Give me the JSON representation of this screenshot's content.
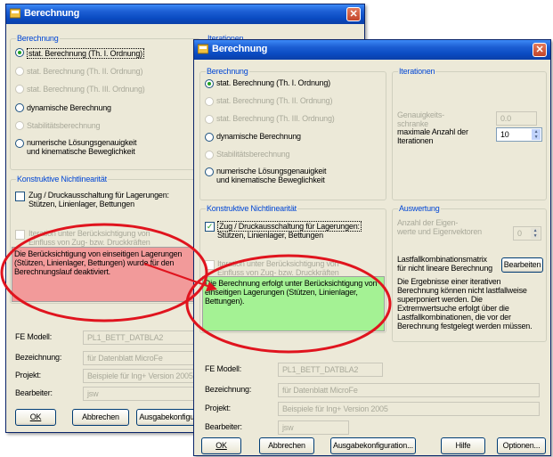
{
  "colors": {
    "title_gradient": "#0a4bc2",
    "group_title": "#0046d5",
    "red_notice": "#f29a9a",
    "green_notice": "#a4f294",
    "ellipse": "#e0141e",
    "arrow": "#e0141e"
  },
  "back": {
    "title": "Berechnung",
    "calc_group": "Berechnung",
    "options": [
      "stat. Berechnung (Th. I. Ordnung)",
      "stat. Berechnung (Th. II. Ordnung)",
      "stat. Berechnung (Th. III. Ordnung)",
      "dynamische Berechnung",
      "Stabilitätsberechnung",
      "numerische Lösungsgenauigkeit",
      "und kinematische Beweglichkeit"
    ],
    "iter_peek": "Iterationen",
    "nonlin_group": "Konstruktive Nichtlinearität",
    "zug_line1": "Zug / Druckausschaltung für Lagerungen:",
    "zug_line2": "Stützen, Linienlager, Bettungen",
    "iter_line1": "Iteration unter Berücksichtigung von",
    "iter_line2": "Einfluss von Zug- bzw. Druckkräften",
    "notice": "Die Berücksichtigung von einseitigen Lagerungen (Stützen, Linienlager, Bettungen) wurde für den Berechnungslauf deaktiviert.",
    "fe_label": "FE Modell:",
    "fe_value": "PL1_BETT_DATBLA2",
    "bez_label": "Bezeichnung:",
    "bez_value": "für Datenblatt MicroFe",
    "proj_label": "Projekt:",
    "proj_value": "Beispiele für Ing+ Version 2005",
    "bearb_label": "Bearbeiter:",
    "bearb_value": "jsw",
    "ok": "OK",
    "abbrechen": "Abbrechen",
    "ausgabe": "Ausgabekonfigura"
  },
  "front": {
    "title": "Berechnung",
    "calc_group": "Berechnung",
    "options": [
      "stat. Berechnung (Th. I. Ordnung)",
      "stat. Berechnung (Th. II. Ordnung)",
      "stat. Berechnung (Th. III. Ordnung)",
      "dynamische Berechnung",
      "Stabilitätsberechnung",
      "numerische Lösungsgenauigkeit",
      "und kinematische Beweglichkeit"
    ],
    "iter_group": "Iterationen",
    "genauig_line1": "Genauigkeits-",
    "genauig_line2": "schranke",
    "genauig_value": "0.0",
    "maxiter_line1": "maximale Anzahl der",
    "maxiter_line2": "Iterationen",
    "maxiter_value": "10",
    "nonlin_group": "Konstruktive Nichtlinearität",
    "zug_line1": "Zug / Druckausschaltung für Lagerungen:",
    "zug_line2": "Stützen, Linienlager, Bettungen",
    "iter_line1": "Iteration unter Berücksichtigung von",
    "iter_line2": "Einfluss von Zug- bzw. Druckkräften",
    "notice": "Die Berechnung erfolgt unter Berücksichtigung von einseitigen Lagerungen (Stützen, Linienlager, Bettungen).",
    "ausw_group": "Auswertung",
    "eigen_line1": "Anzahl der Eigen-",
    "eigen_line2": "werte und Eigenvektoren",
    "eigen_value": "0",
    "matrix_line1": "Lastfallkombinationsmatrix",
    "matrix_line2": "für nicht lineare Berechnung",
    "bearbeiten": "Bearbeiten",
    "ausw_text": "Die Ergebnisse einer iterativen Berechnung können nicht lastfallweise superponiert werden. Die Extremwertsuche erfolgt über die Lastfallkombinationen, die vor der Berechnung festgelegt werden müssen.",
    "fe_label": "FE Modell:",
    "fe_value": "PL1_BETT_DATBLA2",
    "bez_label": "Bezeichnung:",
    "bez_value": "für Datenblatt MicroFe",
    "proj_label": "Projekt:",
    "proj_value": "Beispiele für Ing+ Version 2005",
    "bearb_label": "Bearbeiter:",
    "bearb_value": "jsw",
    "ok": "OK",
    "abbrechen": "Abbrechen",
    "ausgabe": "Ausgabekonfiguration...",
    "hilfe": "Hilfe",
    "optionen": "Optionen..."
  }
}
